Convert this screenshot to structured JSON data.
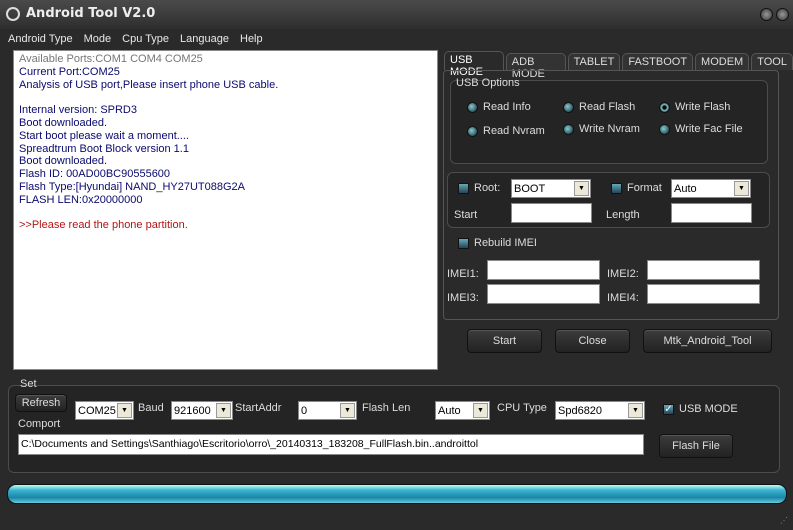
{
  "window": {
    "title": "Android Tool V2.0"
  },
  "menu": [
    "Android Type",
    "Mode",
    "Cpu Type",
    "Language",
    "Help"
  ],
  "log": [
    {
      "text": "Available Ports:COM1 COM4 COM25",
      "style": "gray"
    },
    {
      "text": "Current Port:COM25",
      "style": ""
    },
    {
      "text": "Analysis of USB port,Please insert phone USB cable.",
      "style": ""
    },
    {
      "text": "",
      "style": ""
    },
    {
      "text": "Internal version: SPRD3",
      "style": ""
    },
    {
      "text": "Boot downloaded.",
      "style": ""
    },
    {
      "text": "Start boot please wait a moment....",
      "style": ""
    },
    {
      "text": "Spreadtrum Boot Block version 1.1",
      "style": ""
    },
    {
      "text": "Boot downloaded.",
      "style": ""
    },
    {
      "text": "Flash ID: 00AD00BC90555600",
      "style": ""
    },
    {
      "text": "Flash Type:[Hyundai] NAND_HY27UT088G2A",
      "style": ""
    },
    {
      "text": "FLASH LEN:0x20000000",
      "style": ""
    },
    {
      "text": "",
      "style": ""
    },
    {
      "text": ">>Please read the phone partition.",
      "style": "red"
    }
  ],
  "tabs": [
    "USB MODE",
    "ADB MODE",
    "TABLET",
    "FASTBOOT",
    "MODEM",
    "TOOL"
  ],
  "active_tab": 0,
  "usb_options": {
    "title": "USB Options",
    "options": [
      "Read Info",
      "Read Flash",
      "Write Flash",
      "Read Nvram",
      "Write Nvram",
      "Write Fac File"
    ],
    "selected": "Write Flash"
  },
  "root": {
    "label": "Root:",
    "value": "BOOT",
    "checked": false
  },
  "format": {
    "label": "Format",
    "value": "Auto",
    "checked": false
  },
  "start_label": "Start",
  "length_label": "Length",
  "rebuild_imei": {
    "label": "Rebuild IMEI",
    "checked": false
  },
  "imei_labels": [
    "IMEI1:",
    "IMEI2:",
    "IMEI3:",
    "IMEI4:"
  ],
  "buttons": {
    "start": "Start",
    "close": "Close",
    "mtk": "Mtk_Android_Tool",
    "refresh": "Refresh",
    "flash_file": "Flash File"
  },
  "set": {
    "title": "Set",
    "comport_label": "Comport",
    "comport": "COM25",
    "baud_label": "Baud",
    "baud": "921600",
    "startaddr_label": "StartAddr",
    "startaddr": "0",
    "flashlen_label": "Flash Len",
    "flashlen": "Auto",
    "cpu_label": "CPU Type",
    "cpu": "Spd6820",
    "usb_mode_label": "USB MODE",
    "usb_mode_checked": true,
    "file_path": "C:\\Documents and Settings\\Santhiago\\Escritorio\\orro\\_20140313_183208_FullFlash.bin..androittol"
  },
  "progress_percent": 100,
  "colors": {
    "background": "#2a2a2a",
    "progress": "#2ea8cc",
    "log_text": "#0a0a6e",
    "log_error": "#b01515"
  }
}
